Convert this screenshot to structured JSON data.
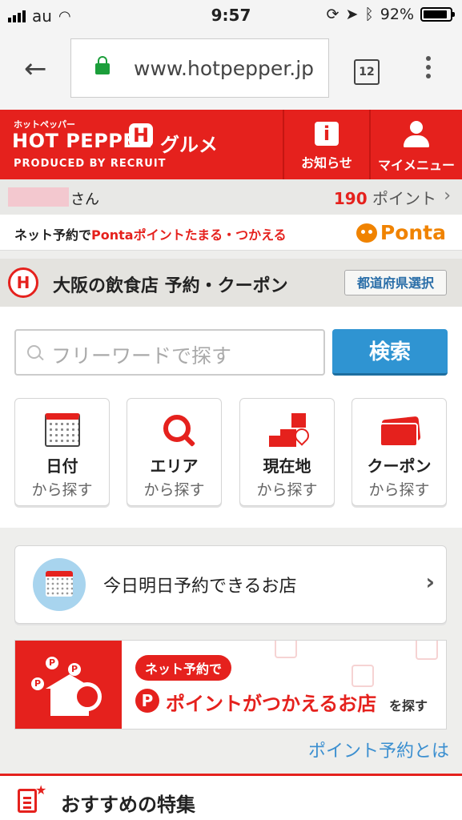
{
  "status_bar": {
    "carrier": "au",
    "time": "9:57",
    "battery": "92%"
  },
  "browser": {
    "url": "www.hotpepper.jp",
    "tab_count": "12"
  },
  "header": {
    "brand_small": "ホットペッパー",
    "brand_main": "HOT PEPPER",
    "brand_icon": "H",
    "brand_gurume": "グルメ",
    "produced_by": "PRODUCED BY",
    "recruit": "RECRUIT",
    "news_label": "お知らせ",
    "mymenu_label": "マイメニュー"
  },
  "user": {
    "suffix": "さん",
    "points_value": "190",
    "points_label": "ポイント"
  },
  "ponta_banner": {
    "prefix": "ネット予約で",
    "highlight": "Pontaポイントたまる・つかえる",
    "logo": "Ponta"
  },
  "section": {
    "title": "大阪の飲食店 予約・クーポン",
    "prefecture_button": "都道府県選択"
  },
  "search": {
    "placeholder": "フリーワードで探す",
    "button": "検索"
  },
  "categories": [
    {
      "title": "日付",
      "sub": "から探す"
    },
    {
      "title": "エリア",
      "sub": "から探す"
    },
    {
      "title": "現在地",
      "sub": "から探す"
    },
    {
      "title": "クーポン",
      "sub": "から探す"
    }
  ],
  "today": {
    "label": "今日明日予約できるお店"
  },
  "point_banner": {
    "bubble": "ネット予約で",
    "main": "ポイントがつかえるお店",
    "suffix": "を探す"
  },
  "point_link": "ポイント予約とは",
  "recommend": {
    "title": "おすすめの特集"
  }
}
